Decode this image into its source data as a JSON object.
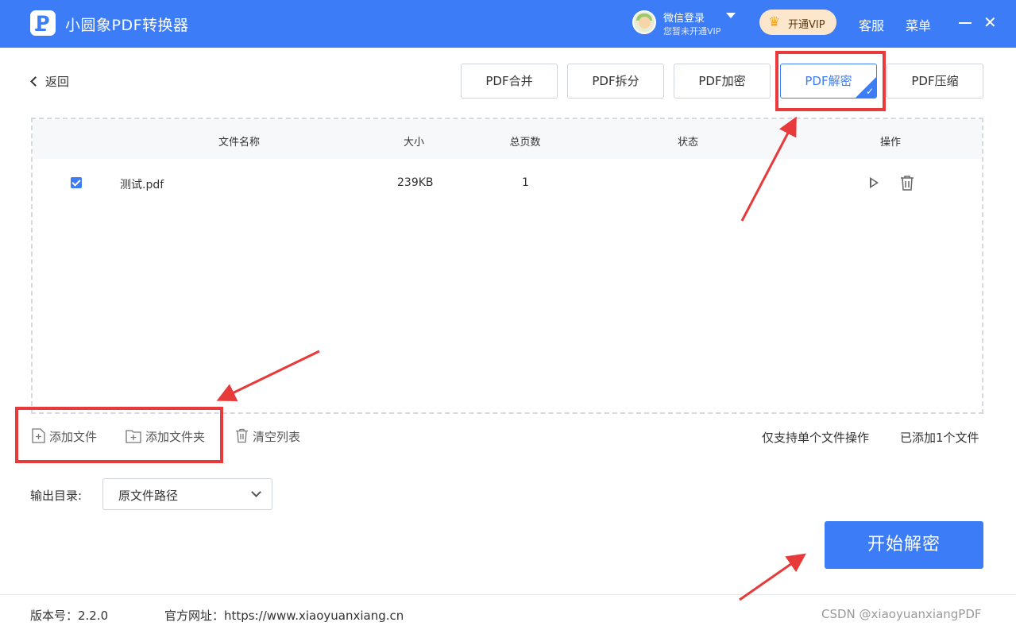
{
  "titlebar": {
    "app_title": "小圆象PDF转换器",
    "logo_letter": "P",
    "login_name": "微信登录",
    "login_sub": "您暂未开通VIP",
    "vip_label": "开通VIP",
    "service_label": "客服",
    "menu_label": "菜单",
    "close_glyph": "✕"
  },
  "back_label": "返回",
  "tabs": [
    {
      "label": "PDF合并",
      "active": false
    },
    {
      "label": "PDF拆分",
      "active": false
    },
    {
      "label": "PDF加密",
      "active": false
    },
    {
      "label": "PDF解密",
      "active": true
    },
    {
      "label": "PDF压缩",
      "active": false
    }
  ],
  "table": {
    "headers": {
      "name": "文件名称",
      "size": "大小",
      "pages": "总页数",
      "status": "状态",
      "actions": "操作"
    },
    "rows": [
      {
        "checked": true,
        "name": "测试.pdf",
        "size": "239KB",
        "pages": "1",
        "status": ""
      }
    ]
  },
  "actions": {
    "add_file": "添加文件",
    "add_folder": "添加文件夹",
    "clear_list": "清空列表"
  },
  "info": {
    "single_only": "仅支持单个文件操作",
    "added_count": "已添加1个文件"
  },
  "output": {
    "label": "输出目录:",
    "selected": "原文件路径"
  },
  "start_button": "开始解密",
  "footer": {
    "version": "版本号：2.2.0",
    "website": "官方网址：https://www.xiaoyuanxiang.cn",
    "watermark": "CSDN @xiaoyuanxiangPDF"
  },
  "colors": {
    "brand_blue": "#3c7cf6",
    "annotation_red": "#e83a3a",
    "vip_bg": "#fde7cc"
  },
  "icons": [
    "logo-icon",
    "avatar",
    "chevron-down-icon",
    "crown-icon",
    "minimize-icon",
    "close-icon",
    "chevron-left-icon",
    "check-icon",
    "play-icon",
    "trash-icon",
    "add-file-icon",
    "add-folder-icon",
    "clear-list-icon"
  ]
}
